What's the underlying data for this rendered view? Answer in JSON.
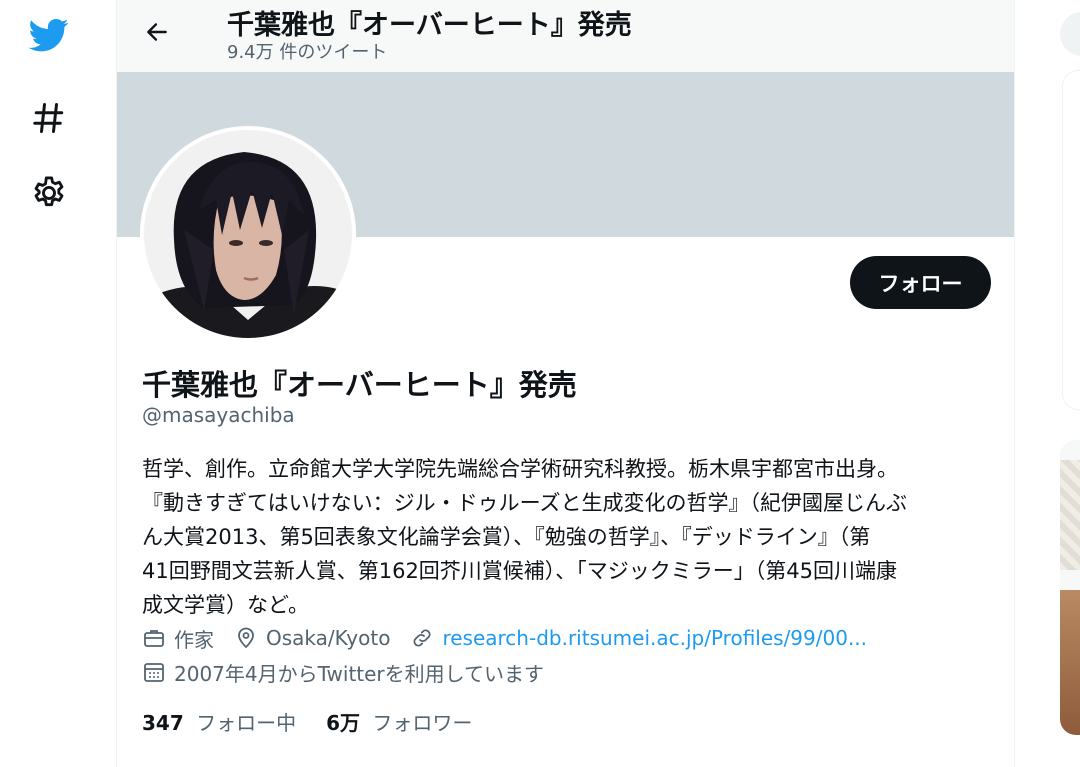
{
  "window": {
    "title": "千葉雅也『オーバーヒート』発売"
  },
  "nav": {
    "items": [
      {
        "name": "twitter-logo",
        "icon": "bird-icon"
      },
      {
        "name": "explore",
        "icon": "hashtag-icon"
      },
      {
        "name": "settings",
        "icon": "gear-icon"
      }
    ]
  },
  "header": {
    "title": "千葉雅也『オーバーヒート』発売",
    "subtitle": "9.4万 件のツイート",
    "back_icon": "back-arrow-icon"
  },
  "profile": {
    "name": "千葉雅也『オーバーヒート』発売",
    "handle": "@masayachiba",
    "follow_label": "フォロー",
    "bio": "哲学、創作。立命館大学大学院先端総合学術研究科教授。栃木県宇都宮市出身。\n『動きすぎてはいけない：ジル・ドゥルーズと生成変化の哲学』（紀伊國屋じんぶ\nん大賞2013、第5回表象文化論学会賞）、『勉強の哲学』、『デッドライン』（第\n41回野間文芸新人賞、第162回芥川賞候補）、「マジックミラー」（第45回川端康\n成文学賞）など。",
    "profession": "作家",
    "location": "Osaka/Kyoto",
    "url": "research-db.ritsumei.ac.jp/Profiles/99/00...",
    "joined": "2007年4月からTwitterを利用しています",
    "following_count": "347",
    "following_label": "フォロー中",
    "followers_count": "6万",
    "followers_label": "フォロワー"
  },
  "colors": {
    "accent": "#1d9bf0",
    "text": "#0f1419",
    "secondary": "#536471",
    "banner": "#cfd9de",
    "follow_button": "#0f1419"
  }
}
